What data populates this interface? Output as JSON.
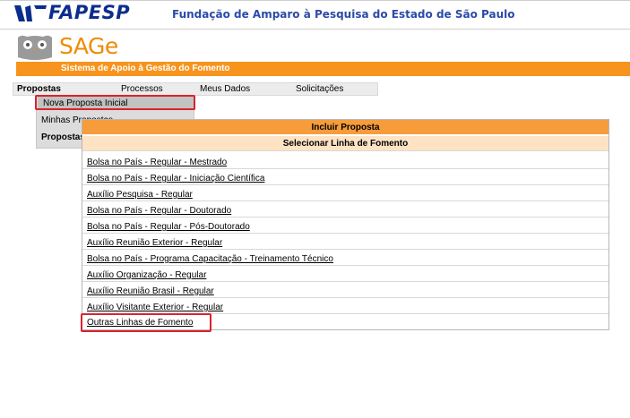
{
  "header": {
    "fapesp_logo_text": "FAPESP",
    "institution_title": "Fundação de Amparo à Pesquisa do Estado de São Paulo"
  },
  "sage": {
    "logo_text": "SAGe",
    "system_name": "Sistema de Apoio à Gestão do Fomento"
  },
  "menu": {
    "items": [
      "Propostas",
      "Processos",
      "Meus Dados",
      "Solicitações"
    ],
    "active": "Propostas"
  },
  "dropdown": {
    "items": [
      "Nova Proposta Inicial",
      "Minhas Propostas",
      "Propostas de que Participo"
    ],
    "highlighted": "Nova Proposta Inicial"
  },
  "main": {
    "title": "Incluir Proposta",
    "subtitle": "Selecionar Linha de Fomento",
    "links": [
      "Bolsa no País - Regular - Mestrado",
      "Bolsa no País - Regular - Iniciação Científica",
      "Auxílio Pesquisa - Regular",
      "Bolsa no País - Regular - Doutorado",
      "Bolsa no País - Regular - Pós-Doutorado",
      "Auxílio Reunião Exterior - Regular",
      "Bolsa no País - Programa Capacitação - Treinamento Técnico",
      "Auxílio Organização - Regular",
      "Auxílio Reunião Brasil - Regular",
      "Auxílio Visitante Exterior - Regular",
      "Outras Linhas de Fomento"
    ]
  },
  "colors": {
    "brand_blue": "#0c2d8c",
    "title_blue": "#2c4aa8",
    "orange": "#f7941d",
    "light_orange": "#fde3c4",
    "highlight_red": "#d9232d"
  }
}
